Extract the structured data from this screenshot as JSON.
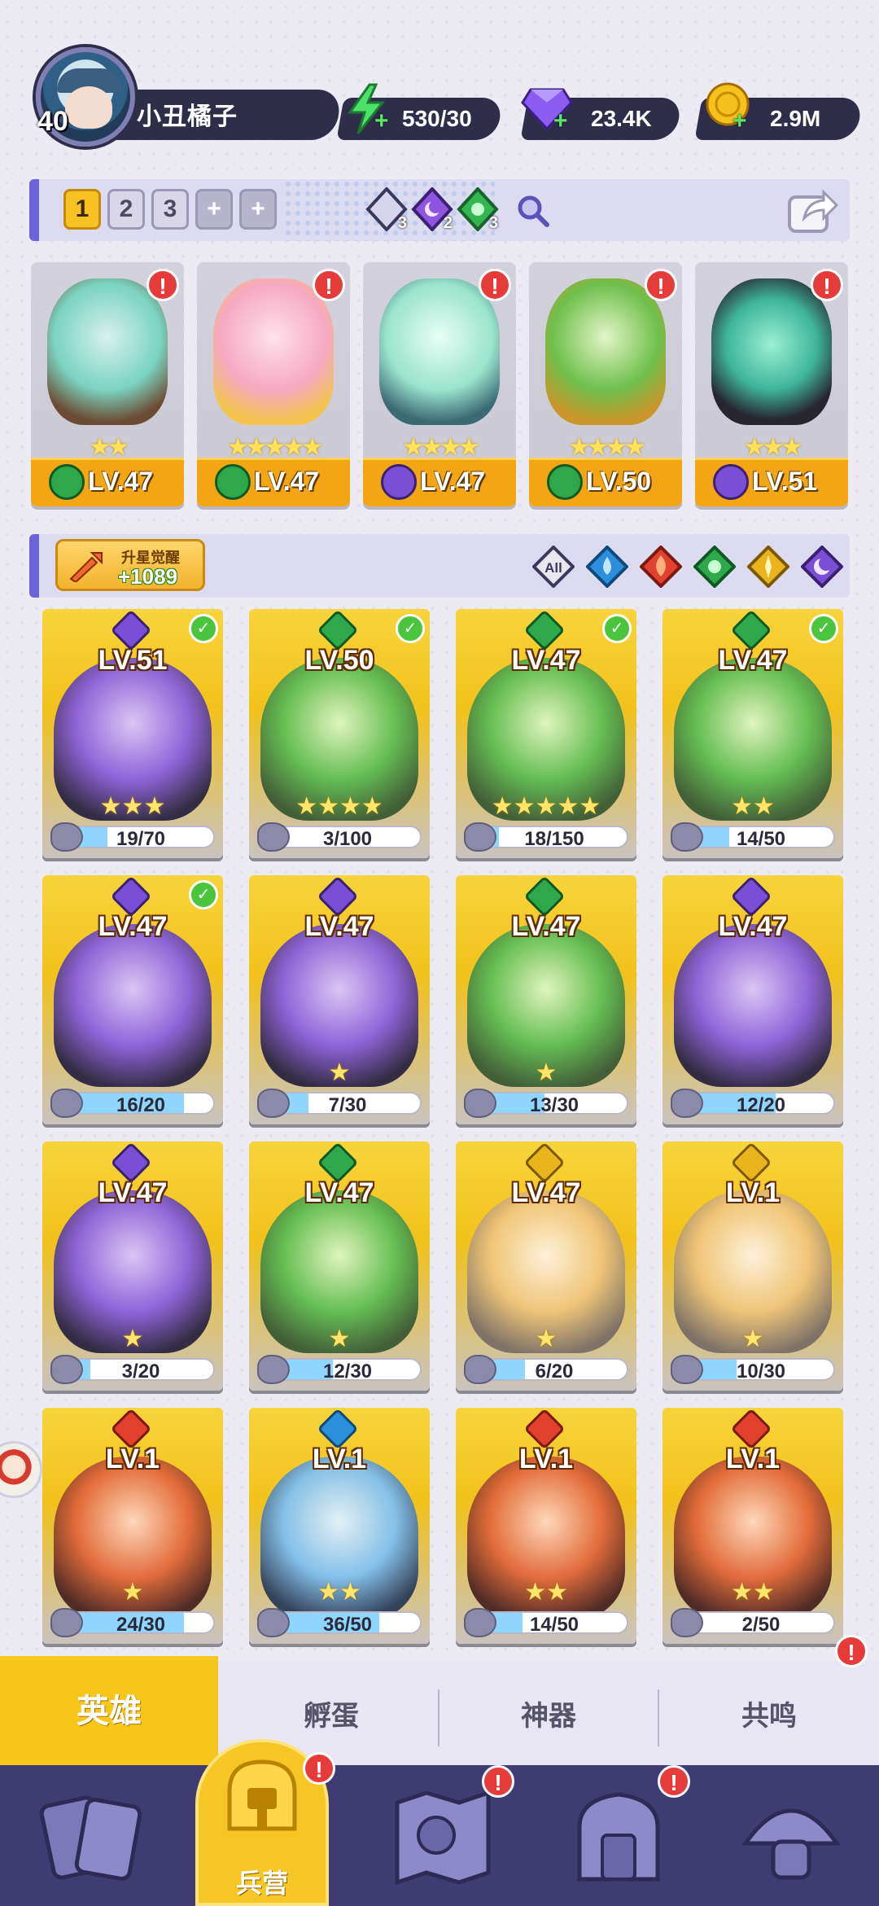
{
  "player": {
    "level": "40",
    "name": "小丑橘子"
  },
  "resources": {
    "energy": "530/30",
    "gems": "23.4K",
    "coins": "2.9M"
  },
  "team": {
    "slots": [
      "1",
      "2",
      "3",
      "+",
      "+"
    ],
    "active_slot": "1",
    "gem_counts": [
      "3",
      "2",
      "3"
    ],
    "cards": [
      {
        "level": "LV.47",
        "stars": "★★",
        "element": "nature"
      },
      {
        "level": "LV.47",
        "stars": "★★★★★",
        "element": "nature"
      },
      {
        "level": "LV.47",
        "stars": "★★★★",
        "element": "dark"
      },
      {
        "level": "LV.50",
        "stars": "★★★★",
        "element": "nature"
      },
      {
        "level": "LV.51",
        "stars": "★★★",
        "element": "dark"
      }
    ]
  },
  "awaken": {
    "title": "升星觉醒",
    "value": "+1089"
  },
  "filters": {
    "all_label": "All",
    "elements": [
      "water",
      "fire",
      "nature",
      "light",
      "dark"
    ]
  },
  "heroes": [
    {
      "level": "LV.51",
      "element": "dark",
      "stars": "★★★",
      "fragments": "19/70",
      "ratio": 0.27,
      "checked": true
    },
    {
      "level": "LV.50",
      "element": "nature",
      "stars": "★★★★",
      "fragments": "3/100",
      "ratio": 0.03,
      "checked": true
    },
    {
      "level": "LV.47",
      "element": "nature",
      "stars": "★★★★★",
      "fragments": "18/150",
      "ratio": 0.12,
      "checked": true
    },
    {
      "level": "LV.47",
      "element": "nature",
      "stars": "★★",
      "fragments": "14/50",
      "ratio": 0.28,
      "checked": true
    },
    {
      "level": "LV.47",
      "element": "dark",
      "stars": "",
      "fragments": "16/20",
      "ratio": 0.8,
      "checked": true
    },
    {
      "level": "LV.47",
      "element": "dark",
      "stars": "★",
      "fragments": "7/30",
      "ratio": 0.23,
      "checked": false
    },
    {
      "level": "LV.47",
      "element": "nature",
      "stars": "★",
      "fragments": "13/30",
      "ratio": 0.43,
      "checked": false
    },
    {
      "level": "LV.47",
      "element": "dark",
      "stars": "",
      "fragments": "12/20",
      "ratio": 0.6,
      "checked": false
    },
    {
      "level": "LV.47",
      "element": "dark",
      "stars": "★",
      "fragments": "3/20",
      "ratio": 0.15,
      "checked": false
    },
    {
      "level": "LV.47",
      "element": "nature",
      "stars": "★",
      "fragments": "12/30",
      "ratio": 0.4,
      "checked": false
    },
    {
      "level": "LV.47",
      "element": "light",
      "stars": "★",
      "fragments": "6/20",
      "ratio": 0.3,
      "checked": false
    },
    {
      "level": "LV.1",
      "element": "light",
      "stars": "★",
      "fragments": "10/30",
      "ratio": 0.33,
      "checked": false
    },
    {
      "level": "LV.1",
      "element": "fire",
      "stars": "★",
      "fragments": "24/30",
      "ratio": 0.8,
      "checked": false
    },
    {
      "level": "LV.1",
      "element": "water",
      "stars": "★★",
      "fragments": "36/50",
      "ratio": 0.72,
      "checked": false
    },
    {
      "level": "LV.1",
      "element": "fire",
      "stars": "★★",
      "fragments": "14/50",
      "ratio": 0.28,
      "checked": false
    },
    {
      "level": "LV.1",
      "element": "fire",
      "stars": "★★",
      "fragments": "2/50",
      "ratio": 0.04,
      "checked": false
    }
  ],
  "subtabs": [
    "英雄",
    "孵蛋",
    "神器",
    "共鸣"
  ],
  "bottom_nav": {
    "active_label": "兵营"
  },
  "colors": {
    "dark": "#7a4fd6",
    "nature": "#2fa84b",
    "fire": "#e2412e",
    "water": "#2c8fdc",
    "light": "#e8b51d",
    "accent": "#f7c61b",
    "navy": "#3f3c74"
  },
  "alert_glyph": "!",
  "check_glyph": "✓"
}
